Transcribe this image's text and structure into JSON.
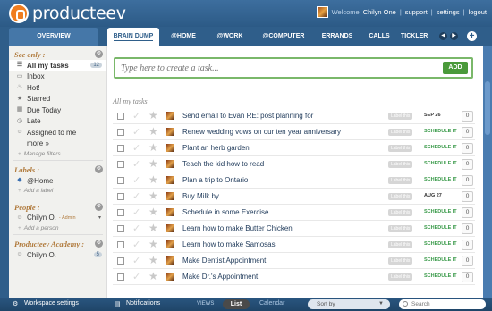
{
  "header": {
    "logo_text": "producteev",
    "welcome": "Welcome",
    "username": "Chilyn One",
    "links": [
      "support",
      "settings",
      "logout"
    ],
    "separators": [
      "|",
      "|"
    ]
  },
  "nav": {
    "overview_label": "OVERVIEW",
    "tabs": [
      "BRAIN DUMP",
      "@HOME",
      "@WORK",
      "@COMPUTER",
      "ERRANDS",
      "CALLS",
      "TICKLER"
    ],
    "active_tab": "BRAIN DUMP",
    "prev": "◀",
    "next": "▶",
    "add": "+"
  },
  "sidebar": {
    "see_only": {
      "title": "See only :",
      "items": [
        {
          "label": "All my tasks",
          "count": "12",
          "selected": true
        },
        {
          "label": "Inbox"
        },
        {
          "label": "Hot!"
        },
        {
          "label": "Starred"
        },
        {
          "label": "Due Today"
        },
        {
          "label": "Late"
        },
        {
          "label": "Assigned to me"
        },
        {
          "label": "more »"
        }
      ],
      "manage": "Manage filters"
    },
    "labels": {
      "title": "Labels :",
      "items": [
        {
          "label": "@Home"
        }
      ],
      "add": "Add a label"
    },
    "people": {
      "title": "People :",
      "items": [
        {
          "label": "Chilyn O.",
          "tag": "- Admin"
        }
      ],
      "add": "Add a person"
    },
    "academy": {
      "title": "Producteev Academy :",
      "items": [
        {
          "label": "Chilyn O.",
          "count": "5"
        }
      ]
    }
  },
  "main": {
    "new_task_placeholder": "Type here to create a task...",
    "add_label": "ADD",
    "list_title": "All my tasks",
    "label_tag": "Label this",
    "tasks": [
      {
        "title": "Send email to Evan RE: post planning for",
        "due": "SEP 26",
        "comments": "0"
      },
      {
        "title": "Renew wedding vows on our ten year anniversary",
        "due": "SCHEDULE IT",
        "comments": "0"
      },
      {
        "title": "Plant an herb garden",
        "due": "SCHEDULE IT",
        "comments": "0"
      },
      {
        "title": "Teach the kid how to read",
        "due": "SCHEDULE IT",
        "comments": "0"
      },
      {
        "title": "Plan a trip to Ontario",
        "due": "SCHEDULE IT",
        "comments": "0"
      },
      {
        "title": "Buy Milk by",
        "due": "AUG 27",
        "comments": "0"
      },
      {
        "title": "Schedule in some Exercise",
        "due": "SCHEDULE IT",
        "comments": "0"
      },
      {
        "title": "Learn how to make Butter Chicken",
        "due": "SCHEDULE IT",
        "comments": "0"
      },
      {
        "title": "Learn how to make Samosas",
        "due": "SCHEDULE IT",
        "comments": "0"
      },
      {
        "title": "Make Dentist Appointment",
        "due": "SCHEDULE IT",
        "comments": "0"
      },
      {
        "title": "Make Dr.'s Appointment",
        "due": "SCHEDULE IT",
        "comments": "0"
      }
    ]
  },
  "footer": {
    "workspace": "Workspace settings",
    "notifications": "Notifications",
    "views": "VIEWS",
    "list": "List",
    "calendar": "Calendar",
    "sort": "Sort by",
    "search_placeholder": "Search"
  },
  "colors": {
    "brand_blue": "#2f5e8a",
    "accent_green": "#4a9a3a",
    "schedule_green": "#3a9a4a",
    "logo_orange": "#f07d1f"
  }
}
